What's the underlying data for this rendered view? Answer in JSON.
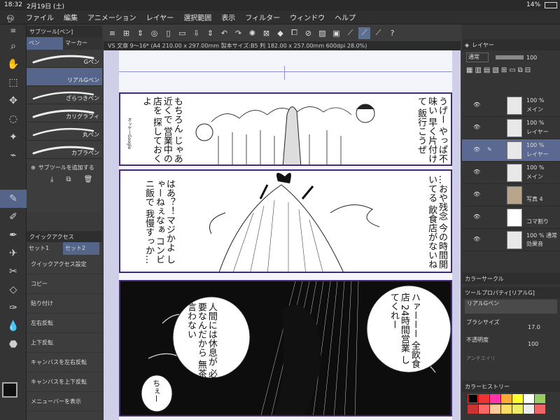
{
  "status": {
    "time": "18:32",
    "date": "2月19日 (土)",
    "battery": "14%"
  },
  "menu": [
    "ファイル",
    "編集",
    "アニメーション",
    "レイヤー",
    "選択範囲",
    "表示",
    "フィルター",
    "ウィンドウ",
    "ヘルプ"
  ],
  "doc_tab": "VS 文章 9〜16* (A4 210.00 x 297.00mm 製本サイズ:B5 判 182.00 x 257.00mm 600dpi 28.0%)",
  "subtool": {
    "tabs": [
      "サブツール[ペン]",
      "ペン",
      "マーカー"
    ],
    "brushes": [
      "Gペン",
      "リアルGペン",
      "ざらつきペン",
      "カリグラフィ",
      "丸ペン",
      "カブラペン"
    ],
    "add_label": "サブツールを追加する"
  },
  "quick": {
    "title": "クイックアクセス",
    "sets": [
      "セット1",
      "セット2"
    ],
    "items": [
      "クイックアクセス設定",
      "コピー",
      "貼り付け",
      "左右反転",
      "上下反転",
      "キャンバスを左右反転",
      "キャンバスを上下反転",
      "メニューバーを表示"
    ]
  },
  "layers": {
    "title": "レイヤー",
    "blend": "通常",
    "opacity": "100",
    "items": [
      {
        "pct": "100 %",
        "name": "メイン"
      },
      {
        "pct": "100 %",
        "name": "レイヤー"
      },
      {
        "pct": "100 %",
        "name": "レイヤー"
      },
      {
        "pct": "100 %",
        "name": "メイン"
      },
      {
        "pct": "",
        "name": "写真 4"
      },
      {
        "pct": "",
        "name": "コマ割り"
      },
      {
        "pct": "100 % 通常",
        "name": "効果音"
      }
    ]
  },
  "color_circle": "カラーサークル",
  "toolprop": {
    "title": "ツールプロパティ[リアルG]",
    "tool": "リアルGペン",
    "brush_size_label": "ブラシサイズ",
    "brush_size": "17.0",
    "opacity_label": "不透明度",
    "opacity": "100",
    "aa_label": "アンチエイリ"
  },
  "history": "カラーヒストリー",
  "manga": {
    "p1_right": "うげー やっぱ不味い 早く片付けて 飯行こうぜ",
    "p1_left": "もちろん じゃあ近くで 営業中の店を 探しておくよ",
    "p1_small": "オッケーGoogle",
    "p2_right": "…おや残念 今の時間開いてる 飲食店がないね",
    "p2_left": "はあ？！マジかよ しゃーねぇなぁ コンビニ飯で 我慢すっか…",
    "p3_right": "ハァーーー 全飲食店 24時間営業 してくれー",
    "p3_left": "人間には休息が 必要なんだから 無茶言わない",
    "p3_small": "ちぇー"
  }
}
